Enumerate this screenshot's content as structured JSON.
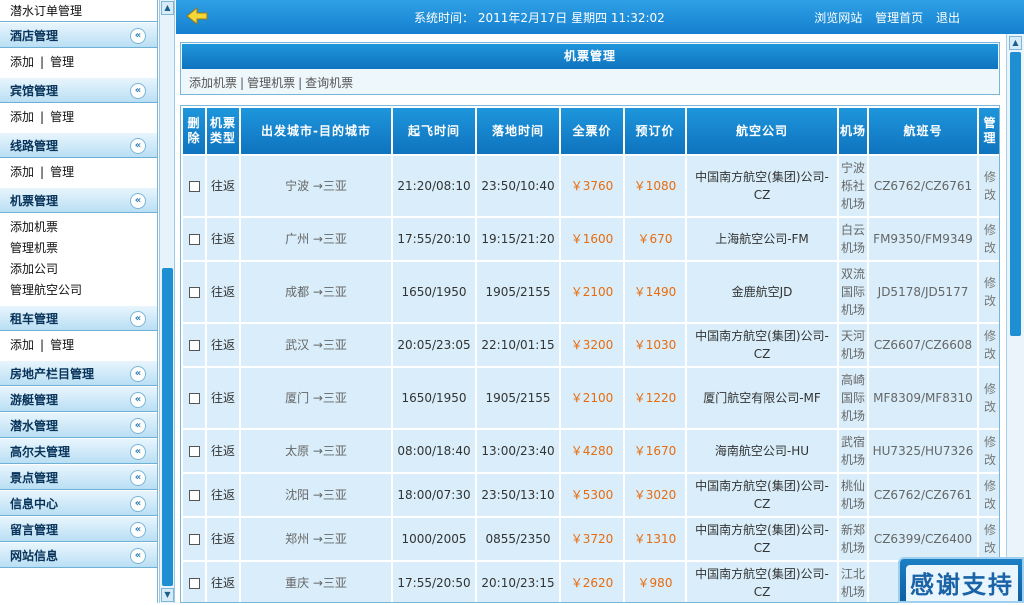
{
  "sidebar": {
    "top_item": "潜水订单管理",
    "groups": [
      {
        "title": "酒店管理",
        "lines": [
          [
            "添加",
            "管理"
          ]
        ]
      },
      {
        "title": "宾馆管理",
        "lines": [
          [
            "添加",
            "管理"
          ]
        ]
      },
      {
        "title": "线路管理",
        "lines": [
          [
            "添加",
            "管理"
          ]
        ]
      },
      {
        "title": "机票管理",
        "lines": [
          [
            "添加机票"
          ],
          [
            "管理机票"
          ],
          [
            "添加公司"
          ],
          [
            "管理航空公司"
          ]
        ]
      },
      {
        "title": "租车管理",
        "lines": [
          [
            "添加",
            "管理"
          ]
        ]
      },
      {
        "title": "房地产栏目管理",
        "lines": []
      },
      {
        "title": "游艇管理",
        "lines": []
      },
      {
        "title": "潜水管理",
        "lines": []
      },
      {
        "title": "高尔夫管理",
        "lines": []
      },
      {
        "title": "景点管理",
        "lines": []
      },
      {
        "title": "信息中心",
        "lines": []
      },
      {
        "title": "留言管理",
        "lines": []
      },
      {
        "title": "网站信息",
        "lines": []
      }
    ],
    "line_sep": "|",
    "chevron": "«"
  },
  "topbar": {
    "clock": "系统时间：  2011年2月17日  星期四  11:32:02",
    "links": [
      "浏览网站",
      "管理首页",
      "退出"
    ]
  },
  "panel": {
    "title": "机票管理",
    "subnav": [
      "添加机票",
      "管理机票",
      "查询机票"
    ]
  },
  "table": {
    "headers": [
      "删除",
      "机票类型",
      "出发城市-目的城市",
      "起飞时间",
      "落地时间",
      "全票价",
      "预订价",
      "航空公司",
      "机场",
      "航班号",
      "管理"
    ],
    "rows": [
      {
        "type": "往返",
        "route": "宁波 →三亚",
        "dep": "21:20/08:10",
        "arr": "23:50/10:40",
        "full": "￥3760",
        "book": "￥1080",
        "airline": "中国南方航空(集团)公司-CZ",
        "airport": "宁波栎社机场",
        "flight": "CZ6762/CZ6761",
        "mgr": "修改"
      },
      {
        "type": "往返",
        "route": "广州 →三亚",
        "dep": "17:55/20:10",
        "arr": "19:15/21:20",
        "full": "￥1600",
        "book": "￥670",
        "airline": "上海航空公司-FM",
        "airport": "白云机场",
        "flight": "FM9350/FM9349",
        "mgr": "修改"
      },
      {
        "type": "往返",
        "route": "成都 →三亚",
        "dep": "1650/1950",
        "arr": "1905/2155",
        "full": "￥2100",
        "book": "￥1490",
        "airline": "金鹿航空JD",
        "airport": "双流国际机场",
        "flight": "JD5178/JD5177",
        "mgr": "修改"
      },
      {
        "type": "往返",
        "route": "武汉 →三亚",
        "dep": "20:05/23:05",
        "arr": "22:10/01:15",
        "full": "￥3200",
        "book": "￥1030",
        "airline": "中国南方航空(集团)公司-CZ",
        "airport": "天河机场",
        "flight": "CZ6607/CZ6608",
        "mgr": "修改"
      },
      {
        "type": "往返",
        "route": "厦门 →三亚",
        "dep": "1650/1950",
        "arr": "1905/2155",
        "full": "￥2100",
        "book": "￥1220",
        "airline": "厦门航空有限公司-MF",
        "airport": "高崎国际机场",
        "flight": "MF8309/MF8310",
        "mgr": "修改"
      },
      {
        "type": "往返",
        "route": "太原 →三亚",
        "dep": "08:00/18:40",
        "arr": "13:00/23:40",
        "full": "￥4280",
        "book": "￥1670",
        "airline": "海南航空公司-HU",
        "airport": "武宿机场",
        "flight": "HU7325/HU7326",
        "mgr": "修改"
      },
      {
        "type": "往返",
        "route": "沈阳 →三亚",
        "dep": "18:00/07:30",
        "arr": "23:50/13:10",
        "full": "￥5300",
        "book": "￥3020",
        "airline": "中国南方航空(集团)公司-CZ",
        "airport": "桃仙机场",
        "flight": "CZ6762/CZ6761",
        "mgr": "修改"
      },
      {
        "type": "往返",
        "route": "郑州 →三亚",
        "dep": "1000/2005",
        "arr": "0855/2350",
        "full": "￥3720",
        "book": "￥1310",
        "airline": "中国南方航空(集团)公司-CZ",
        "airport": "新郑机场",
        "flight": "CZ6399/CZ6400",
        "mgr": "修改"
      },
      {
        "type": "往返",
        "route": "重庆 →三亚",
        "dep": "17:55/20:50",
        "arr": "20:10/23:15",
        "full": "￥2620",
        "book": "￥980",
        "airline": "中国南方航空(集团)公司-CZ",
        "airport": "江北机场",
        "flight": "CZ8",
        "mgr": "修改"
      }
    ]
  },
  "banner": {
    "text": "感谢支持"
  },
  "colors": {
    "accent": "#1480cf",
    "price": "#e76b0f",
    "cell": "#d9eefa",
    "border": "#7bb6d8"
  }
}
